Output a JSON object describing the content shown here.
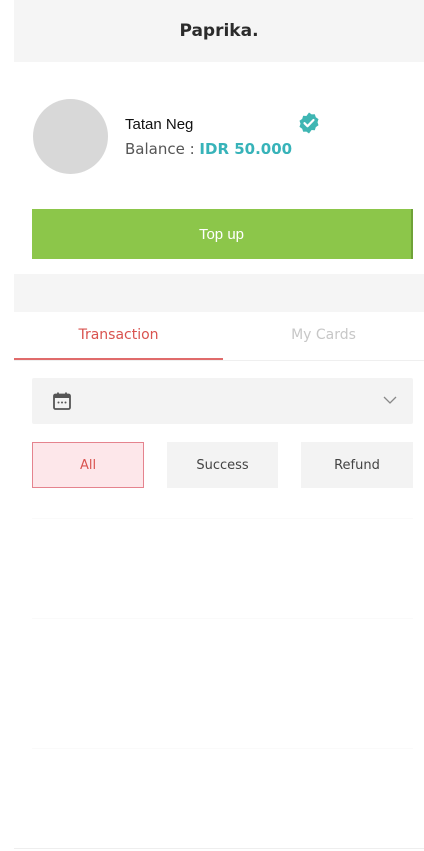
{
  "header": {
    "title": "Paprika."
  },
  "profile": {
    "name": "Tatan Neg",
    "balance_label": "Balance : ",
    "balance_value": "IDR 50.000",
    "verified_icon": "verified-badge-icon"
  },
  "actions": {
    "topup_label": "Top up"
  },
  "tabs": [
    {
      "label": "Transaction",
      "active": true
    },
    {
      "label": "My Cards",
      "active": false
    }
  ],
  "date_filter": {
    "icon": "calendar-icon",
    "value": ""
  },
  "filters": [
    {
      "label": "All",
      "selected": true
    },
    {
      "label": "Success",
      "selected": false
    },
    {
      "label": "Refund",
      "selected": false
    }
  ],
  "colors": {
    "accent_green": "#8cc64a",
    "accent_teal": "#37b3b9",
    "accent_red": "#d9534f"
  }
}
